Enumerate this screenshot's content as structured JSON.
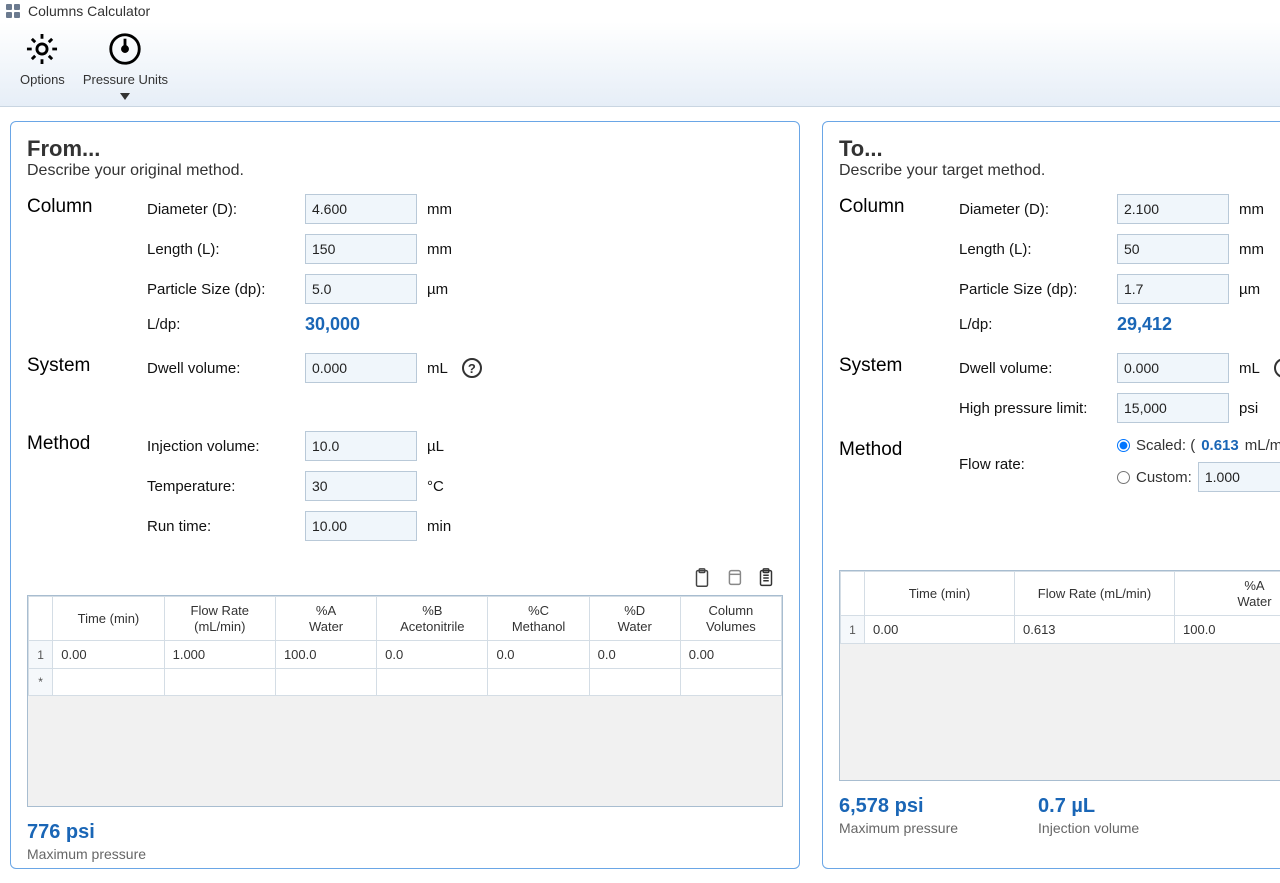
{
  "title_bar": {
    "title": "Columns Calculator"
  },
  "ribbon": {
    "options_label": "Options",
    "pressure_units_label": "Pressure Units"
  },
  "from": {
    "heading": "From...",
    "subtitle": "Describe your original method.",
    "column_section": "Column",
    "system_section": "System",
    "method_section": "Method",
    "diameter_label": "Diameter (D):",
    "diameter_value": "4.600",
    "diameter_unit": "mm",
    "length_label": "Length (L):",
    "length_value": "150",
    "length_unit": "mm",
    "particle_label": "Particle Size (dp):",
    "particle_value": "5.0",
    "particle_unit": "µm",
    "ldp_label": "L/dp:",
    "ldp_value": "30,000",
    "dwell_label": "Dwell volume:",
    "dwell_value": "0.000",
    "dwell_unit": "mL",
    "injection_label": "Injection volume:",
    "injection_value": "10.0",
    "injection_unit": "µL",
    "temperature_label": "Temperature:",
    "temperature_value": "30",
    "temperature_unit": "°C",
    "runtime_label": "Run time:",
    "runtime_value": "10.00",
    "runtime_unit": "min",
    "grid": {
      "headers": {
        "time": "Time (min)",
        "flow": "Flow Rate (mL/min)",
        "a_top": "%A",
        "a_sub": "Water",
        "b_top": "%B",
        "b_sub": "Acetonitrile",
        "c_top": "%C",
        "c_sub": "Methanol",
        "d_top": "%D",
        "d_sub": "Water",
        "cv": "Column Volumes"
      },
      "row1": {
        "n": "1",
        "time": "0.00",
        "flow": "1.000",
        "a": "100.0",
        "b": "0.0",
        "c": "0.0",
        "d": "0.0",
        "cv": "0.00"
      },
      "row_star": "*"
    },
    "summary": {
      "pressure_value": "776 psi",
      "pressure_label": "Maximum pressure"
    }
  },
  "to": {
    "heading": "To...",
    "subtitle": "Describe your target method.",
    "column_section": "Column",
    "system_section": "System",
    "method_section": "Method",
    "diameter_label": "Diameter (D):",
    "diameter_value": "2.100",
    "diameter_unit": "mm",
    "length_label": "Length (L):",
    "length_value": "50",
    "length_unit": "mm",
    "particle_label": "Particle Size (dp):",
    "particle_value": "1.7",
    "particle_unit": "µm",
    "ldp_label": "L/dp:",
    "ldp_value": "29,412",
    "dwell_label": "Dwell volume:",
    "dwell_value": "0.000",
    "dwell_unit": "mL",
    "hpl_label": "High pressure limit:",
    "hpl_value": "15,000",
    "hpl_unit": "psi",
    "flowrate_label": "Flow rate:",
    "scaled_label": "Scaled: (",
    "scaled_value": "0.613",
    "scaled_unit": "mL/m",
    "custom_label": "Custom:",
    "custom_value": "1.000",
    "grid": {
      "headers": {
        "time": "Time (min)",
        "flow": "Flow Rate (mL/min)",
        "a_top": "%A",
        "a_sub": "Water"
      },
      "row1": {
        "n": "1",
        "time": "0.00",
        "flow": "0.613",
        "a": "100.0"
      }
    },
    "summary": {
      "pressure_value": "6,578 psi",
      "pressure_label": "Maximum pressure",
      "inj_value": "0.7  µL",
      "inj_label": "Injection volume"
    }
  }
}
